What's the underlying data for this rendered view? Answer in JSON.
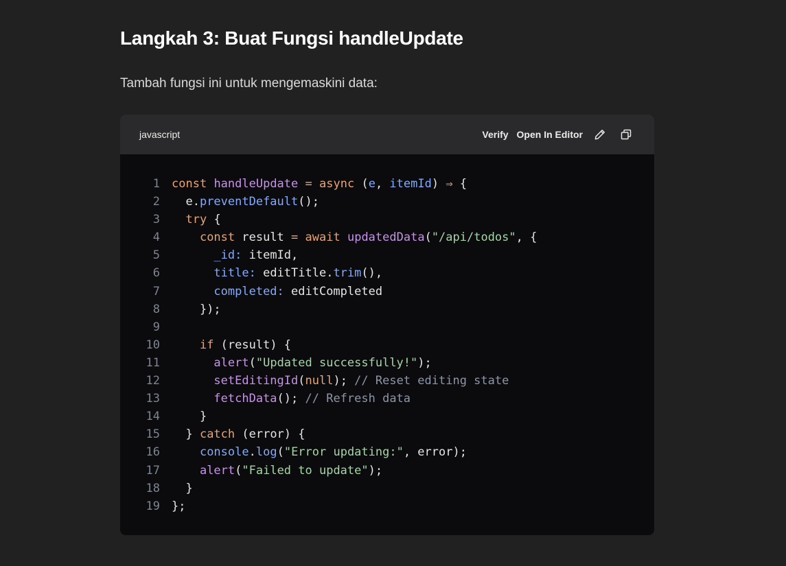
{
  "heading": "Langkah 3: Buat Fungsi handleUpdate",
  "paragraph": "Tambah fungsi ini untuk mengemaskini data:",
  "code_block": {
    "language": "javascript",
    "verify_label": "Verify",
    "open_editor_label": "Open In Editor",
    "edit_icon": "pencil-icon",
    "copy_icon": "copy-icon",
    "lines": [
      [
        {
          "t": "k",
          "v": "const"
        },
        {
          "t": "v",
          "v": " "
        },
        {
          "t": "f",
          "v": "handleUpdate"
        },
        {
          "t": "v",
          "v": " "
        },
        {
          "t": "k",
          "v": "="
        },
        {
          "t": "v",
          "v": " "
        },
        {
          "t": "k",
          "v": "async"
        },
        {
          "t": "v",
          "v": " ("
        },
        {
          "t": "p",
          "v": "e"
        },
        {
          "t": "v",
          "v": ", "
        },
        {
          "t": "p",
          "v": "itemId"
        },
        {
          "t": "v",
          "v": ") "
        },
        {
          "t": "k",
          "v": "⇒"
        },
        {
          "t": "v",
          "v": " {"
        }
      ],
      [
        {
          "t": "v",
          "v": "  e."
        },
        {
          "t": "p",
          "v": "preventDefault"
        },
        {
          "t": "v",
          "v": "();"
        }
      ],
      [
        {
          "t": "v",
          "v": "  "
        },
        {
          "t": "k",
          "v": "try"
        },
        {
          "t": "v",
          "v": " {"
        }
      ],
      [
        {
          "t": "v",
          "v": "    "
        },
        {
          "t": "k",
          "v": "const"
        },
        {
          "t": "v",
          "v": " result "
        },
        {
          "t": "k",
          "v": "="
        },
        {
          "t": "v",
          "v": " "
        },
        {
          "t": "k",
          "v": "await"
        },
        {
          "t": "v",
          "v": " "
        },
        {
          "t": "f",
          "v": "updatedData"
        },
        {
          "t": "v",
          "v": "("
        },
        {
          "t": "s",
          "v": "\"/api/todos\""
        },
        {
          "t": "v",
          "v": ", {"
        }
      ],
      [
        {
          "t": "v",
          "v": "      "
        },
        {
          "t": "p",
          "v": "_id:"
        },
        {
          "t": "v",
          "v": " itemId,"
        }
      ],
      [
        {
          "t": "v",
          "v": "      "
        },
        {
          "t": "p",
          "v": "title:"
        },
        {
          "t": "v",
          "v": " editTitle."
        },
        {
          "t": "p",
          "v": "trim"
        },
        {
          "t": "v",
          "v": "(),"
        }
      ],
      [
        {
          "t": "v",
          "v": "      "
        },
        {
          "t": "p",
          "v": "completed:"
        },
        {
          "t": "v",
          "v": " editCompleted"
        }
      ],
      [
        {
          "t": "v",
          "v": "    });"
        }
      ],
      [],
      [
        {
          "t": "v",
          "v": "    "
        },
        {
          "t": "k",
          "v": "if"
        },
        {
          "t": "v",
          "v": " (result) {"
        }
      ],
      [
        {
          "t": "v",
          "v": "      "
        },
        {
          "t": "f",
          "v": "alert"
        },
        {
          "t": "v",
          "v": "("
        },
        {
          "t": "s",
          "v": "\"Updated successfully!\""
        },
        {
          "t": "v",
          "v": ");"
        }
      ],
      [
        {
          "t": "v",
          "v": "      "
        },
        {
          "t": "f",
          "v": "setEditingId"
        },
        {
          "t": "v",
          "v": "("
        },
        {
          "t": "k",
          "v": "null"
        },
        {
          "t": "v",
          "v": "); "
        },
        {
          "t": "c",
          "v": "// Reset editing state"
        }
      ],
      [
        {
          "t": "v",
          "v": "      "
        },
        {
          "t": "f",
          "v": "fetchData"
        },
        {
          "t": "v",
          "v": "(); "
        },
        {
          "t": "c",
          "v": "// Refresh data"
        }
      ],
      [
        {
          "t": "v",
          "v": "    }"
        }
      ],
      [
        {
          "t": "v",
          "v": "  } "
        },
        {
          "t": "k",
          "v": "catch"
        },
        {
          "t": "v",
          "v": " (error) {"
        }
      ],
      [
        {
          "t": "v",
          "v": "    "
        },
        {
          "t": "p",
          "v": "console"
        },
        {
          "t": "v",
          "v": "."
        },
        {
          "t": "p",
          "v": "log"
        },
        {
          "t": "v",
          "v": "("
        },
        {
          "t": "s",
          "v": "\"Error updating:\""
        },
        {
          "t": "v",
          "v": ", error);"
        }
      ],
      [
        {
          "t": "v",
          "v": "    "
        },
        {
          "t": "f",
          "v": "alert"
        },
        {
          "t": "v",
          "v": "("
        },
        {
          "t": "s",
          "v": "\"Failed to update\""
        },
        {
          "t": "v",
          "v": ");"
        }
      ],
      [
        {
          "t": "v",
          "v": "  }"
        }
      ],
      [
        {
          "t": "v",
          "v": "};"
        }
      ]
    ]
  }
}
